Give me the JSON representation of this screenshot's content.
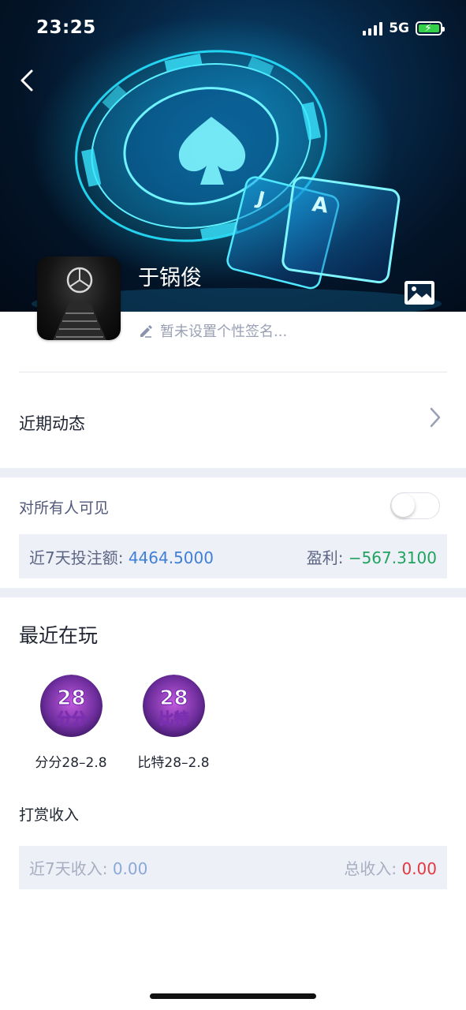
{
  "status_bar": {
    "time": "23:25",
    "network": "5G"
  },
  "profile": {
    "name": "于锅俊",
    "signature_placeholder": "暂未设置个性签名..."
  },
  "recent_activity": {
    "label": "近期动态"
  },
  "visibility": {
    "label": "对所有人可见",
    "enabled": false
  },
  "betting": {
    "bet_label": "近7天投注额: ",
    "bet_value": "4464.5000",
    "profit_label": "盈利: ",
    "profit_value": "−567.3100"
  },
  "recently_playing": {
    "title": "最近在玩",
    "games": [
      {
        "name": "分分28–2.8",
        "icon_top": "28",
        "icon_bottom": "分分"
      },
      {
        "name": "比特28–2.8",
        "icon_top": "28",
        "icon_bottom": "比特"
      }
    ]
  },
  "rewards": {
    "title": "打赏收入",
    "recent_label": "近7天收入: ",
    "recent_value": "0.00",
    "total_label": "总收入: ",
    "total_value": "0.00"
  },
  "colors": {
    "bet_value": "#3f7fd6",
    "profit_value": "#1fa35f",
    "total_income": "#e2383f",
    "band": "#eceef6"
  }
}
